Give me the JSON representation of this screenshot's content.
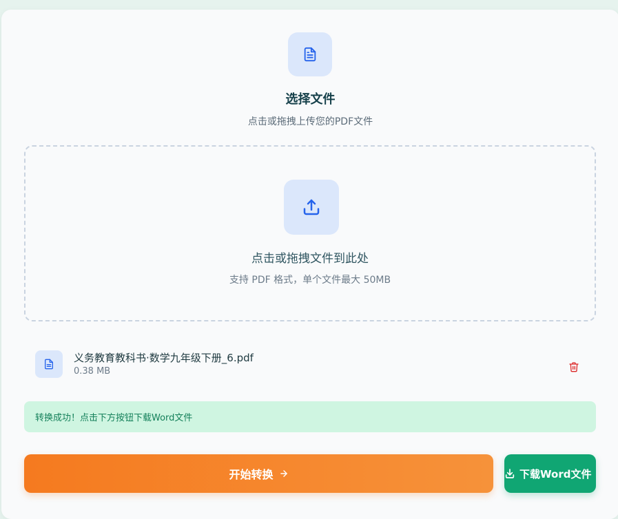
{
  "header": {
    "icon": "file-text-icon",
    "title": "选择文件",
    "subtitle": "点击或拖拽上传您的PDF文件"
  },
  "dropzone": {
    "icon": "upload-icon",
    "main_text": "点击或拖拽文件到此处",
    "hint": "支持 PDF 格式，单个文件最大 50MB"
  },
  "file": {
    "icon": "file-text-icon",
    "name": "义务教育教科书·数学九年级下册_6.pdf",
    "size": "0.38 MB",
    "delete_icon": "trash-icon"
  },
  "status": {
    "message": "转换成功！点击下方按钮下载Word文件",
    "color": "#14805a",
    "background": "#cff5e1"
  },
  "actions": {
    "convert_label": "开始转换",
    "convert_icon": "arrow-right-icon",
    "download_label": "下载Word文件",
    "download_icon": "download-icon"
  },
  "colors": {
    "accent_orange": "#f57a1f",
    "accent_green": "#10a673",
    "icon_blue": "#2563eb",
    "icon_bg": "#dbe7fb",
    "danger": "#dc2626"
  }
}
